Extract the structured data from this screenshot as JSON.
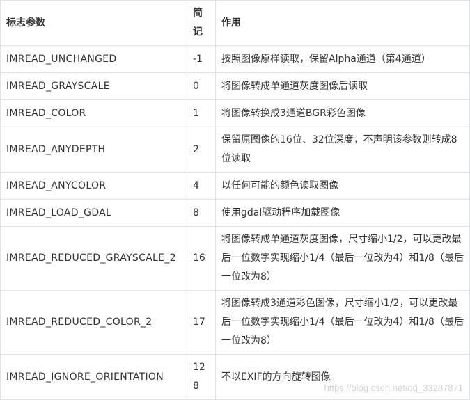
{
  "table": {
    "headers": [
      "标志参数",
      "简记",
      "作用"
    ],
    "rows": [
      {
        "flag": "IMREAD_UNCHANGED",
        "value": "-1",
        "desc": "按照图像原样读取，保留Alpha通道（第4通道）"
      },
      {
        "flag": "IMREAD_GRAYSCALE",
        "value": "0",
        "desc": "将图像转成单通道灰度图像后读取"
      },
      {
        "flag": "IMREAD_COLOR",
        "value": "1",
        "desc": "将图像转换成3通道BGR彩色图像"
      },
      {
        "flag": "IMREAD_ANYDEPTH",
        "value": "2",
        "desc": "保留原图像的16位、32位深度，不声明该参数则转成8位读取"
      },
      {
        "flag": "IMREAD_ANYCOLOR",
        "value": "4",
        "desc": "以任何可能的颜色读取图像"
      },
      {
        "flag": "IMREAD_LOAD_GDAL",
        "value": "8",
        "desc": "使用gdal驱动程序加载图像"
      },
      {
        "flag": "IMREAD_REDUCED_GRAYSCALE_2",
        "value": "16",
        "desc": "将图像转成单通道灰度图像，尺寸缩小1/2，可以更改最后一位数字实现缩小1/4（最后一位改为4）和1/8（最后一位改为8）"
      },
      {
        "flag": "IMREAD_REDUCED_COLOR_2",
        "value": "17",
        "desc": "将图像转成3通道彩色图像，尺寸缩小1/2，可以更改最后一位数字实现缩小1/4（最后一位改为4）和1/8（最后一位改为8）"
      },
      {
        "flag": "IMREAD_IGNORE_ORIENTATION",
        "value": "128",
        "desc": "不以EXIF的方向旋转图像"
      }
    ]
  },
  "watermark": "https://blog.csdn.net/qq_33287871"
}
